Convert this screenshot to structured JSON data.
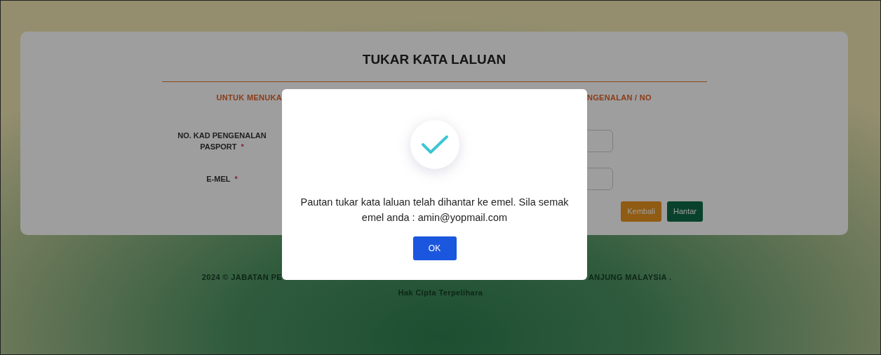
{
  "page": {
    "title": "TUKAR KATA LALUAN",
    "subtitle_left": "UNTUK MENUKA",
    "subtitle_right": "NGENALAN / NO",
    "fields": [
      {
        "label_lines": [
          "NO. KAD PENGENALAN",
          "PASPORT"
        ],
        "required_mark": "*"
      },
      {
        "label_lines": [
          "E-MEL"
        ],
        "required_mark": "*"
      }
    ],
    "buttons": [
      {
        "label": "Kembali",
        "kind": "back"
      },
      {
        "label": "Hantar",
        "kind": "submit"
      }
    ]
  },
  "footer": {
    "line_left": "2024 © JABATAN PE",
    "line_right": "ANJUNG MALAYSIA .",
    "line2": "Hak Cipta Terpelihara"
  },
  "dialog": {
    "message": "Pautan tukar kata laluan telah dihantar ke emel. Sila semak emel anda : amin@yopmail.com",
    "button": "OK"
  }
}
